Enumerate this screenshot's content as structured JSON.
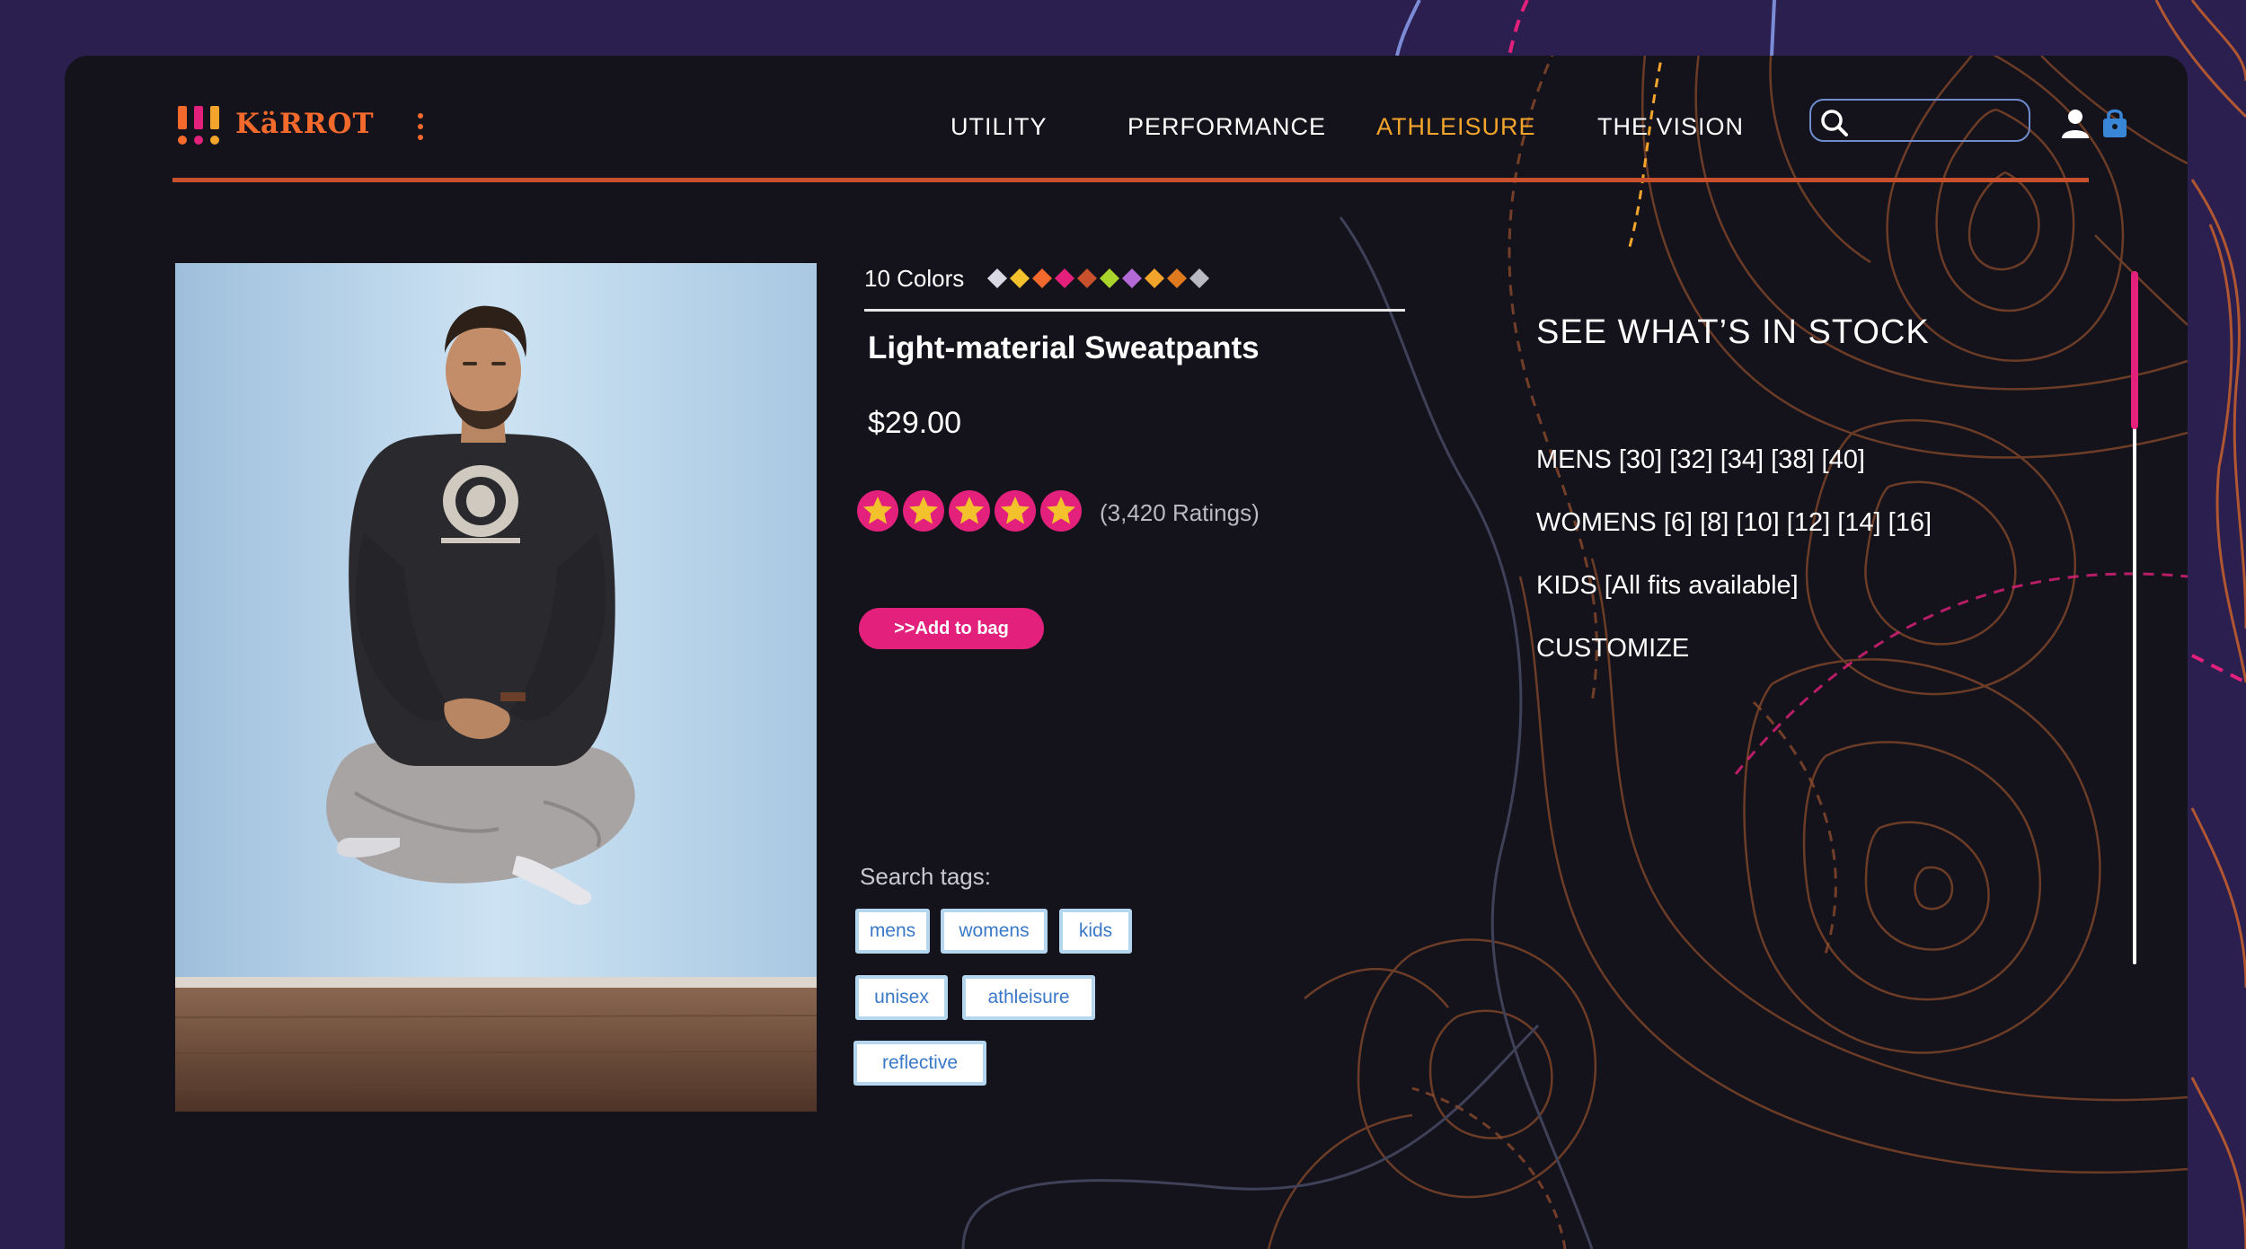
{
  "brand": {
    "name": "KäRROT",
    "accent": "#f36a2c"
  },
  "nav": {
    "items": [
      {
        "label": "UTILITY",
        "active": false
      },
      {
        "label": "PERFORMANCE",
        "active": false
      },
      {
        "label": "ATHLEISURE",
        "active": true
      },
      {
        "label": "THE VISION",
        "active": false
      }
    ],
    "active_color": "#f3a52b"
  },
  "header_icons": [
    "search-icon",
    "user-icon",
    "bag-icon"
  ],
  "search": {
    "placeholder": "",
    "value": ""
  },
  "product": {
    "colors_label": "10 Colors",
    "swatches": [
      "#d9d9e6",
      "#f3c12b",
      "#f36a2c",
      "#e3217c",
      "#c8502c",
      "#a8d42b",
      "#b46ad6",
      "#f3a52b",
      "#e07a1f",
      "#b9b9c4"
    ],
    "title": "Light-material Sweatpants",
    "price": "$29.00",
    "rating_stars": 5,
    "ratings_text": "(3,420 Ratings)",
    "add_to_bag": ">>Add to bag",
    "tags_label": "Search tags:",
    "tags": [
      "mens",
      "womens",
      "kids",
      "unisex",
      "athleisure",
      "reflective"
    ]
  },
  "stock": {
    "title": "SEE WHAT’S IN STOCK",
    "lines": [
      "MENS [30] [32] [34] [38] [40]",
      "WOMENS [6] [8] [10] [12] [14] [16]",
      "KIDS [All fits available]",
      "CUSTOMIZE"
    ]
  },
  "colors": {
    "page_bg": "#2b1f4f",
    "panel_bg": "#14131c",
    "rule": "#c8502c",
    "button": "#e3217c",
    "tag_text": "#3a78c8"
  }
}
